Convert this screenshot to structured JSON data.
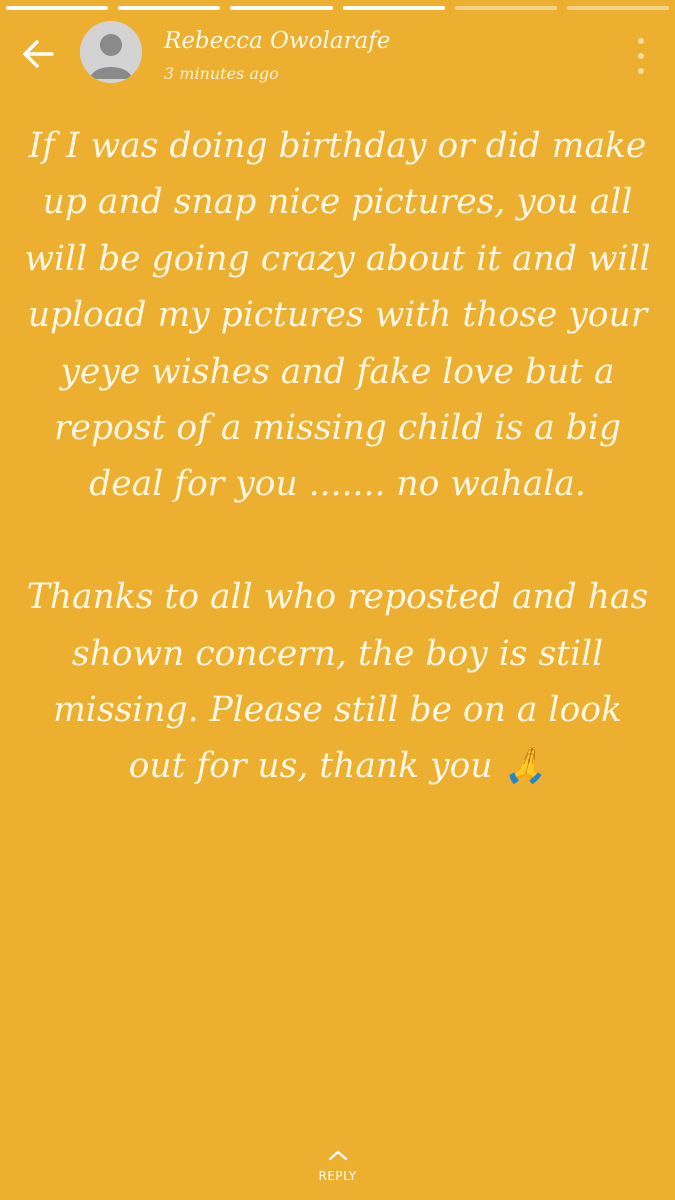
{
  "story": {
    "progress": {
      "segments": 6,
      "completed": 4
    },
    "author_name": "Rebecca Owolarafe",
    "timestamp": "3 minutes ago",
    "background_color": "#ecaf2f",
    "text": {
      "paragraph1": "If I was doing birthday or did make up and snap nice pictures, you all will be going crazy about it and will upload my pictures with those your yeye wishes and fake love but a repost of a missing child is a big deal for you ....... no wahala.",
      "paragraph2": "Thanks to all who reposted and has shown concern, the boy is still missing. Please still be on a look out for us, thank you 🙏"
    },
    "reply_label": "REPLY"
  },
  "icons": {
    "back": "back-arrow-icon",
    "avatar": "default-avatar-icon",
    "menu": "more-vert-icon",
    "reply": "chevron-up-icon"
  }
}
